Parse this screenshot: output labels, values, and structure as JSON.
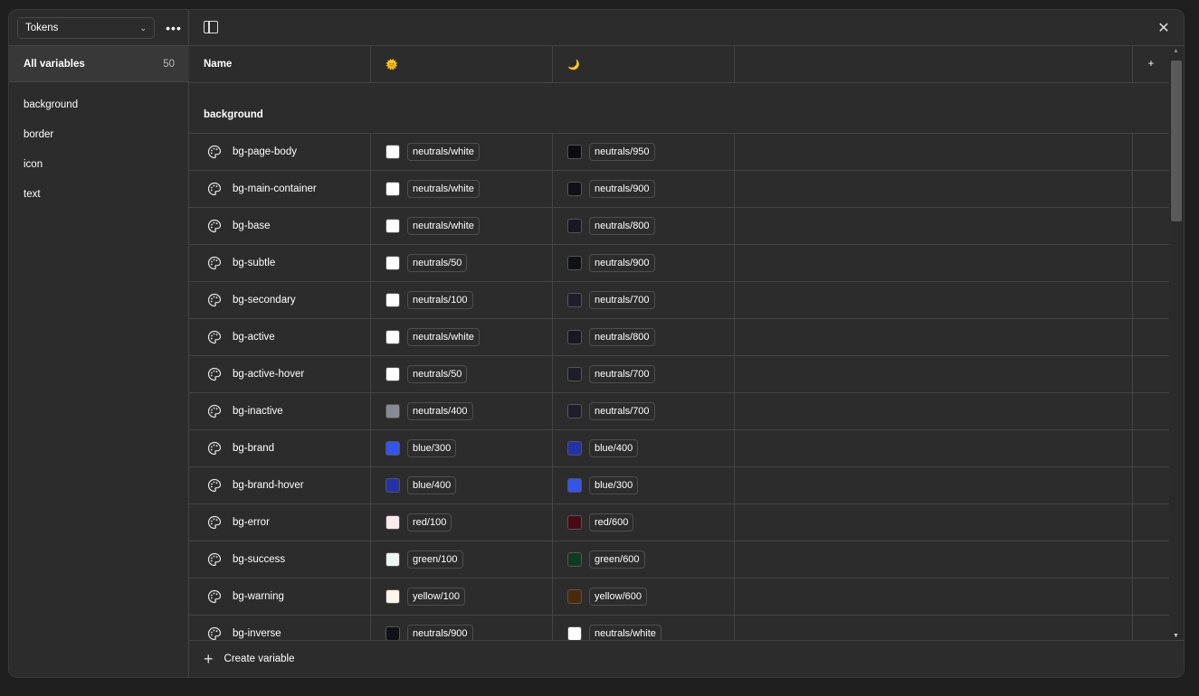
{
  "sidebar": {
    "collection": "Tokens",
    "chevron": "⌄",
    "more": "•••",
    "all_variables": {
      "label": "All variables",
      "count": "50"
    },
    "groups": [
      "background",
      "border",
      "icon",
      "text"
    ]
  },
  "header": {
    "name": "Name",
    "mode_light_icon": "🌞",
    "mode_dark_icon": "🌙",
    "add": "+",
    "close": "✕"
  },
  "group_title": "background",
  "rows": [
    {
      "name": "bg-page-body",
      "light": {
        "swatch": "#ffffff",
        "ref": "neutrals/white"
      },
      "dark": {
        "swatch": "#0c0c10",
        "ref": "neutrals/950"
      }
    },
    {
      "name": "bg-main-container",
      "light": {
        "swatch": "#ffffff",
        "ref": "neutrals/white"
      },
      "dark": {
        "swatch": "#101116",
        "ref": "neutrals/900"
      }
    },
    {
      "name": "bg-base",
      "light": {
        "swatch": "#ffffff",
        "ref": "neutrals/white"
      },
      "dark": {
        "swatch": "#181822",
        "ref": "neutrals/800"
      }
    },
    {
      "name": "bg-subtle",
      "light": {
        "swatch": "#ffffff",
        "ref": "neutrals/50"
      },
      "dark": {
        "swatch": "#101116",
        "ref": "neutrals/900"
      }
    },
    {
      "name": "bg-secondary",
      "light": {
        "swatch": "#ffffff",
        "ref": "neutrals/100"
      },
      "dark": {
        "swatch": "#1e1e2a",
        "ref": "neutrals/700"
      }
    },
    {
      "name": "bg-active",
      "light": {
        "swatch": "#ffffff",
        "ref": "neutrals/white"
      },
      "dark": {
        "swatch": "#181822",
        "ref": "neutrals/800"
      }
    },
    {
      "name": "bg-active-hover",
      "light": {
        "swatch": "#ffffff",
        "ref": "neutrals/50"
      },
      "dark": {
        "swatch": "#1e1e2a",
        "ref": "neutrals/700"
      }
    },
    {
      "name": "bg-inactive",
      "light": {
        "swatch": "#888a94",
        "ref": "neutrals/400"
      },
      "dark": {
        "swatch": "#1e1e2a",
        "ref": "neutrals/700"
      }
    },
    {
      "name": "bg-brand",
      "light": {
        "swatch": "#3355ee",
        "ref": "blue/300"
      },
      "dark": {
        "swatch": "#2233aa",
        "ref": "blue/400"
      }
    },
    {
      "name": "bg-brand-hover",
      "light": {
        "swatch": "#2233aa",
        "ref": "blue/400"
      },
      "dark": {
        "swatch": "#3355ee",
        "ref": "blue/300"
      }
    },
    {
      "name": "bg-error",
      "light": {
        "swatch": "#fde8ec",
        "ref": "red/100"
      },
      "dark": {
        "swatch": "#4a0a14",
        "ref": "red/600"
      }
    },
    {
      "name": "bg-success",
      "light": {
        "swatch": "#eaf8f2",
        "ref": "green/100"
      },
      "dark": {
        "swatch": "#0e3a26",
        "ref": "green/600"
      }
    },
    {
      "name": "bg-warning",
      "light": {
        "swatch": "#fdf6e6",
        "ref": "yellow/100"
      },
      "dark": {
        "swatch": "#4a2a0a",
        "ref": "yellow/600"
      }
    },
    {
      "name": "bg-inverse",
      "light": {
        "swatch": "#101116",
        "ref": "neutrals/900"
      },
      "dark": {
        "swatch": "#ffffff",
        "ref": "neutrals/white"
      }
    }
  ],
  "footer": {
    "create_label": "Create variable",
    "plus": "+"
  }
}
